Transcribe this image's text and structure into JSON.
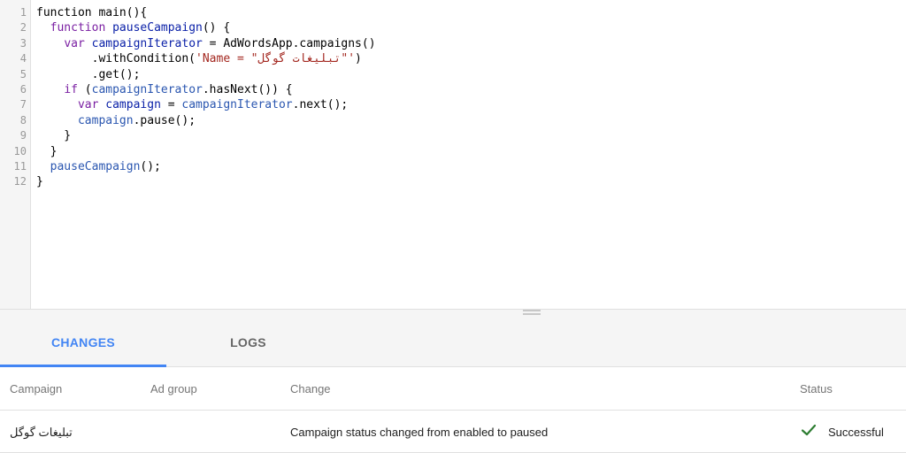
{
  "editor": {
    "line_numbers": [
      "1",
      "2",
      "3",
      "4",
      "5",
      "6",
      "7",
      "8",
      "9",
      "10",
      "11",
      "12"
    ],
    "lines": [
      [
        {
          "t": "function",
          "k": "plain"
        },
        {
          "t": " main(){",
          "k": "plain"
        }
      ],
      [
        {
          "t": "  ",
          "k": "plain"
        },
        {
          "t": "function",
          "k": "kw"
        },
        {
          "t": " pauseCampaign",
          "k": "def"
        },
        {
          "t": "() {",
          "k": "plain"
        }
      ],
      [
        {
          "t": "    ",
          "k": "plain"
        },
        {
          "t": "var",
          "k": "kw"
        },
        {
          "t": " campaignIterator",
          "k": "def"
        },
        {
          "t": " = AdWordsApp.campaigns()",
          "k": "plain"
        }
      ],
      [
        {
          "t": "        .withCondition(",
          "k": "plain"
        },
        {
          "t": "'Name = \"تبلیغات گوگل\"'",
          "k": "str"
        },
        {
          "t": ")",
          "k": "plain"
        }
      ],
      [
        {
          "t": "        .get();",
          "k": "plain"
        }
      ],
      [
        {
          "t": "    ",
          "k": "plain"
        },
        {
          "t": "if",
          "k": "kw"
        },
        {
          "t": " (",
          "k": "plain"
        },
        {
          "t": "campaignIterator",
          "k": "var"
        },
        {
          "t": ".hasNext()) {",
          "k": "plain"
        }
      ],
      [
        {
          "t": "      ",
          "k": "plain"
        },
        {
          "t": "var",
          "k": "kw"
        },
        {
          "t": " campaign",
          "k": "def"
        },
        {
          "t": " = ",
          "k": "plain"
        },
        {
          "t": "campaignIterator",
          "k": "var"
        },
        {
          "t": ".next();",
          "k": "plain"
        }
      ],
      [
        {
          "t": "      ",
          "k": "plain"
        },
        {
          "t": "campaign",
          "k": "var"
        },
        {
          "t": ".pause();",
          "k": "plain"
        }
      ],
      [
        {
          "t": "    }",
          "k": "plain"
        }
      ],
      [
        {
          "t": "  }",
          "k": "plain"
        }
      ],
      [
        {
          "t": "  ",
          "k": "plain"
        },
        {
          "t": "pauseCampaign",
          "k": "var"
        },
        {
          "t": "();",
          "k": "plain"
        }
      ],
      [
        {
          "t": "}",
          "k": "plain"
        }
      ]
    ]
  },
  "tabs": {
    "changes_label": "CHANGES",
    "logs_label": "LOGS",
    "active": "changes"
  },
  "table": {
    "headers": {
      "campaign": "Campaign",
      "ad_group": "Ad group",
      "change": "Change",
      "status": "Status"
    },
    "rows": [
      {
        "campaign": "تبلیغات گوگل",
        "ad_group": "",
        "change": "Campaign status changed from enabled to paused",
        "status": "Successful",
        "status_icon": "check-icon"
      }
    ]
  },
  "colors": {
    "accent": "#4285f4",
    "success": "#2e7d32"
  }
}
